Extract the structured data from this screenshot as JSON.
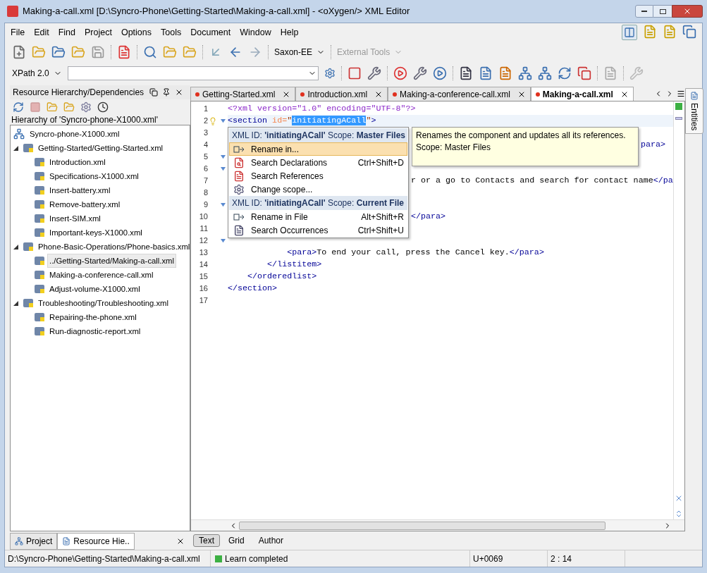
{
  "window": {
    "title": "Making-a-call.xml [D:\\Syncro-Phone\\Getting-Started\\Making-a-call.xml] - <oXygen/> XML Editor"
  },
  "menu": [
    "File",
    "Edit",
    "Find",
    "Project",
    "Options",
    "Tools",
    "Document",
    "Window",
    "Help"
  ],
  "toolbar": {
    "transformer": "Saxon-EE",
    "external_tools": "External Tools",
    "xpath_version": "XPath 2.0"
  },
  "left_panel": {
    "title": "Resource Hierarchy/Dependencies",
    "subtitle": "Hierarchy of 'Syncro-phone-X1000.xml'",
    "tree": [
      {
        "label": "Syncro-phone-X1000.xml",
        "selected": false,
        "children": [
          {
            "label": "Getting-Started/Getting-Started.xml",
            "selected": false,
            "expanded": true,
            "children": [
              {
                "label": "Introduction.xml",
                "selected": false
              },
              {
                "label": "Specifications-X1000.xml",
                "selected": false
              },
              {
                "label": "Insert-battery.xml",
                "selected": false
              },
              {
                "label": "Remove-battery.xml",
                "selected": false
              },
              {
                "label": "Insert-SIM.xml",
                "selected": false
              },
              {
                "label": "Important-keys-X1000.xml",
                "selected": false
              }
            ]
          },
          {
            "label": "Phone-Basic-Operations/Phone-basics.xml",
            "selected": false,
            "expanded": true,
            "children": [
              {
                "label": "../Getting-Started/Making-a-call.xml",
                "selected": true
              },
              {
                "label": "Making-a-conference-call.xml",
                "selected": false
              },
              {
                "label": "Adjust-volume-X1000.xml",
                "selected": false
              }
            ]
          },
          {
            "label": "Troubleshooting/Troubleshooting.xml",
            "selected": false,
            "expanded": true,
            "children": [
              {
                "label": "Repairing-the-phone.xml",
                "selected": false
              },
              {
                "label": "Run-diagnostic-report.xml",
                "selected": false
              }
            ]
          }
        ]
      }
    ],
    "bottom_tabs": [
      {
        "label": "Project",
        "selected": false
      },
      {
        "label": "Resource Hie..",
        "selected": true
      }
    ]
  },
  "editor": {
    "tabs": [
      {
        "label": "Getting-Started.xml",
        "selected": false
      },
      {
        "label": "Introduction.xml",
        "selected": false
      },
      {
        "label": "Making-a-conference-call.xml",
        "selected": false
      },
      {
        "label": "Making-a-call.xml",
        "selected": true
      }
    ],
    "lines": [
      {
        "number": "1",
        "kind": "full",
        "segments": [
          {
            "kind": "pi",
            "text": "<?xml version=\"1.0\" encoding=\"UTF-8\"?>"
          }
        ]
      },
      {
        "number": "2",
        "kind": "full",
        "fold": true,
        "bulb": true,
        "current": true,
        "segments": [
          {
            "kind": "tag",
            "text": "<section"
          },
          {
            "kind": "attr",
            "text": " id="
          },
          {
            "kind": "val",
            "text": "\""
          },
          {
            "kind": "sel",
            "text": "initiatingACall"
          },
          {
            "kind": "val",
            "text": "\""
          },
          {
            "kind": "tag",
            "text": ">"
          }
        ]
      },
      {
        "number": "3"
      },
      {
        "number": "4",
        "kind": "after_tooltip",
        "segments": [
          {
            "kind": "tag",
            "text": "para>"
          }
        ]
      },
      {
        "number": "5",
        "fold": true
      },
      {
        "number": "6",
        "fold": true
      },
      {
        "number": "7",
        "kind": "after_menu",
        "segments": [
          {
            "kind": "text",
            "text": "r or a go to Contacts and search for contact name"
          },
          {
            "kind": "tag",
            "text": "</pa"
          }
        ]
      },
      {
        "number": "8"
      },
      {
        "number": "9",
        "fold": true
      },
      {
        "number": "10",
        "kind": "after_menu",
        "segments": [
          {
            "kind": "tag",
            "text": "</para>"
          }
        ]
      },
      {
        "number": "11"
      },
      {
        "number": "12",
        "fold": true
      },
      {
        "number": "13",
        "kind": "full",
        "segments": [
          {
            "kind": "tag",
            "text": "            <para>"
          },
          {
            "kind": "text",
            "text": "To end your call, press the Cancel key."
          },
          {
            "kind": "tag",
            "text": "</para>"
          }
        ]
      },
      {
        "number": "14",
        "kind": "full",
        "segments": [
          {
            "kind": "tag",
            "text": "        </listitem>"
          }
        ]
      },
      {
        "number": "15",
        "kind": "full",
        "segments": [
          {
            "kind": "tag",
            "text": "    </orderedlist>"
          }
        ]
      },
      {
        "number": "16",
        "kind": "full",
        "segments": [
          {
            "kind": "tag",
            "text": "</section>"
          }
        ]
      },
      {
        "number": "17"
      }
    ],
    "menu": [
      {
        "header": "XML ID: **'initiatingACall'**  Scope: **Master Files**",
        "items": [
          {
            "label": "Rename in...",
            "selected": true,
            "kind": "rename"
          },
          {
            "label": "Search Declarations",
            "shortcut": "Ctrl+Shift+D",
            "selected": false,
            "kind": "declarations"
          },
          {
            "label": "Search References",
            "selected": false,
            "kind": "references"
          },
          {
            "label": "Change scope...",
            "selected": false,
            "kind": "scope"
          }
        ]
      },
      {
        "header": "XML ID: **'initiatingACall'**  Scope: **Current File**",
        "items": [
          {
            "label": "Rename in File",
            "shortcut": "Alt+Shift+R",
            "selected": false,
            "kind": "rename"
          },
          {
            "label": "Search Occurrences",
            "shortcut": "Ctrl+Shift+U",
            "selected": false,
            "kind": "occurrences"
          }
        ]
      }
    ],
    "tooltip": [
      "Renames the component and updates all its references.",
      "Scope: Master Files"
    ],
    "mode_tabs": [
      {
        "label": "Text",
        "selected": true
      },
      {
        "label": "Grid",
        "selected": false
      },
      {
        "label": "Author",
        "selected": false
      }
    ],
    "side_tab": "Entities"
  },
  "status_bar": {
    "path": "D:\\Syncro-Phone\\Getting-Started\\Making-a-call.xml",
    "message": "Learn completed",
    "code_point": "U+0069",
    "position": "2 : 14"
  }
}
